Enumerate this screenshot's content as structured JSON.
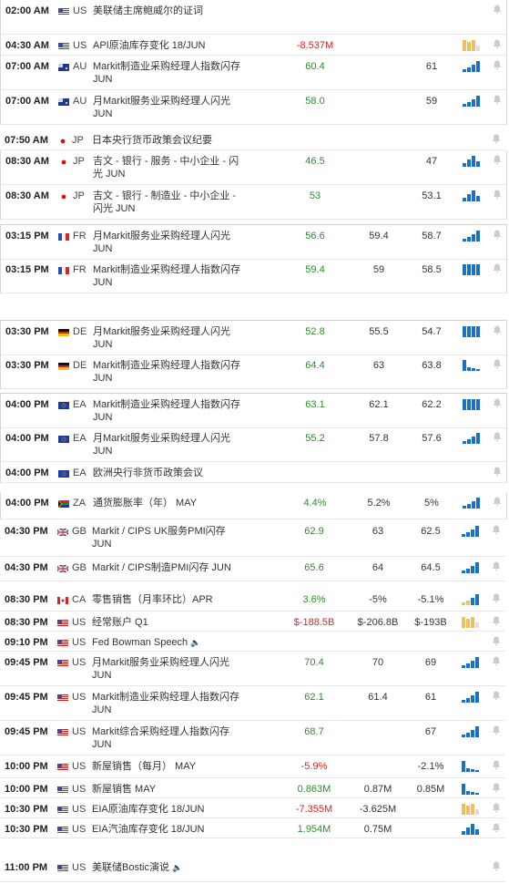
{
  "colors": {
    "positive": "#2e8b2e",
    "negative": "#dd2222",
    "bar": "#1a6fc9",
    "bar_neutral": "#f0c060",
    "bell": "#cccccc"
  },
  "rows": [
    {
      "time": "02:00 AM",
      "flag": "us-flag",
      "cc": "US",
      "event": "美联储主席鲍威尔的证词",
      "actual": "",
      "forecast": "",
      "previous": "",
      "tone": "",
      "bars": "",
      "speaker": false
    },
    {
      "time": "04:30 AM",
      "flag": "us-flag",
      "cc": "US",
      "event": "API原油库存变化 18/JUN",
      "actual": "-8.537M",
      "forecast": "",
      "previous": "",
      "tone": "neg",
      "bars": "neutral",
      "speaker": false
    },
    {
      "time": "07:00 AM",
      "flag": "au-flag",
      "cc": "AU",
      "event": "Markit制造业采购经理人指数闪存 JUN",
      "actual": "60.4",
      "forecast": "",
      "previous": "61",
      "tone": "pos",
      "bars": "up",
      "speaker": false
    },
    {
      "time": "07:00 AM",
      "flag": "au-flag",
      "cc": "AU",
      "event": "月Markit服务业采购经理人闪光 JUN",
      "actual": "58.0",
      "forecast": "",
      "previous": "59",
      "tone": "pos",
      "bars": "up",
      "speaker": false
    },
    {
      "time": "07:50 AM",
      "flag": "jp-flag",
      "cc": "JP",
      "event": "日本央行货币政策会议纪要",
      "actual": "",
      "forecast": "",
      "previous": "",
      "tone": "",
      "bars": "",
      "speaker": false
    },
    {
      "time": "08:30 AM",
      "flag": "jp-flag",
      "cc": "JP",
      "event": "吉文 - 银行 - 服务 - 中小企业 - 闪光 JUN",
      "actual": "46.5",
      "forecast": "",
      "previous": "47",
      "tone": "pos",
      "bars": "mid",
      "speaker": false
    },
    {
      "time": "08:30 AM",
      "flag": "jp-flag",
      "cc": "JP",
      "event": "吉文 - 银行 - 制造业 - 中小企业 - 闪光 JUN",
      "actual": "53",
      "forecast": "",
      "previous": "53.1",
      "tone": "pos",
      "bars": "mid",
      "speaker": false
    },
    {
      "time": "03:15 PM",
      "flag": "fr-flag",
      "cc": "FR",
      "event": "月Markit服务业采购经理人闪光 JUN",
      "actual": "56.6",
      "forecast": "59.4",
      "previous": "58.7",
      "tone": "pos",
      "bars": "up",
      "speaker": false
    },
    {
      "time": "03:15 PM",
      "flag": "fr-flag",
      "cc": "FR",
      "event": "Markit制造业采购经理人指数闪存 JUN",
      "actual": "59.4",
      "forecast": "59",
      "previous": "58.5",
      "tone": "pos",
      "bars": "full",
      "speaker": false
    },
    {
      "time": "03:30 PM",
      "flag": "de-flag",
      "cc": "DE",
      "event": "月Markit服务业采购经理人闪光 JUN",
      "actual": "52.8",
      "forecast": "55.5",
      "previous": "54.7",
      "tone": "pos",
      "bars": "full",
      "speaker": false
    },
    {
      "time": "03:30 PM",
      "flag": "de-flag",
      "cc": "DE",
      "event": "Markit制造业采购经理人指数闪存 JUN",
      "actual": "64.4",
      "forecast": "63",
      "previous": "63.8",
      "tone": "pos",
      "bars": "down",
      "speaker": false
    },
    {
      "time": "04:00 PM",
      "flag": "eu-flag",
      "cc": "EA",
      "event": "Markit制造业采购经理人指数闪存 JUN",
      "actual": "63.1",
      "forecast": "62.1",
      "previous": "62.2",
      "tone": "pos",
      "bars": "full",
      "speaker": false
    },
    {
      "time": "04:00 PM",
      "flag": "eu-flag",
      "cc": "EA",
      "event": "月Markit服务业采购经理人闪光 JUN",
      "actual": "55.2",
      "forecast": "57.8",
      "previous": "57.6",
      "tone": "pos",
      "bars": "up",
      "speaker": false
    },
    {
      "time": "04:00 PM",
      "flag": "eu-flag",
      "cc": "EA",
      "event": "欧洲央行非货币政策会议",
      "actual": "",
      "forecast": "",
      "previous": "",
      "tone": "",
      "bars": "",
      "speaker": false
    },
    {
      "time": "04:00 PM",
      "flag": "za-flag",
      "cc": "ZA",
      "event": "通货膨胀率（年） MAY",
      "actual": "4.4%",
      "forecast": "5.2%",
      "previous": "5%",
      "tone": "pos",
      "bars": "up",
      "speaker": false
    },
    {
      "time": "04:30 PM",
      "flag": "gb-flag",
      "cc": "GB",
      "event": "Markit / CIPS UK服务PMI闪存 JUN",
      "actual": "62.9",
      "forecast": "63",
      "previous": "62.5",
      "tone": "pos",
      "bars": "up",
      "speaker": false
    },
    {
      "time": "04:30 PM",
      "flag": "gb-flag",
      "cc": "GB",
      "event": "Markit / CIPS制造PMI闪存 JUN",
      "actual": "65.6",
      "forecast": "64",
      "previous": "64.5",
      "tone": "pos",
      "bars": "up",
      "speaker": false
    },
    {
      "time": "08:30 PM",
      "flag": "ca-flag",
      "cc": "CA",
      "event": "零售销售（月率环比）APR",
      "actual": "3.6%",
      "forecast": "-5%",
      "previous": "-5.1%",
      "tone": "pos",
      "bars": "neutralup",
      "speaker": false
    },
    {
      "time": "08:30 PM",
      "flag": "us-flag",
      "cc": "US",
      "event": "经常账户 Q1",
      "actual": "$-188.5B",
      "forecast": "$-206.8B",
      "previous": "$-193B",
      "tone": "neg",
      "bars": "neutral",
      "speaker": false
    },
    {
      "time": "09:10 PM",
      "flag": "us-flag",
      "cc": "US",
      "event": "Fed Bowman Speech",
      "actual": "",
      "forecast": "",
      "previous": "",
      "tone": "",
      "bars": "",
      "speaker": true
    },
    {
      "time": "09:45 PM",
      "flag": "us-flag",
      "cc": "US",
      "event": "月Markit服务业采购经理人闪光 JUN",
      "actual": "70.4",
      "forecast": "70",
      "previous": "69",
      "tone": "pos",
      "bars": "up",
      "speaker": false
    },
    {
      "time": "09:45 PM",
      "flag": "us-flag",
      "cc": "US",
      "event": "Markit制造业采购经理人指数闪存 JUN",
      "actual": "62.1",
      "forecast": "61.4",
      "previous": "61",
      "tone": "pos",
      "bars": "up",
      "speaker": false
    },
    {
      "time": "09:45 PM",
      "flag": "us-flag",
      "cc": "US",
      "event": "Markit综合采购经理人指数闪存 JUN",
      "actual": "68.7",
      "forecast": "",
      "previous": "67",
      "tone": "pos",
      "bars": "up",
      "speaker": false
    },
    {
      "time": "10:00 PM",
      "flag": "us-flag",
      "cc": "US",
      "event": "新屋销售（每月） MAY",
      "actual": "-5.9%",
      "forecast": "",
      "previous": "-2.1%",
      "tone": "neg",
      "bars": "down",
      "speaker": false
    },
    {
      "time": "10:00 PM",
      "flag": "us-flag",
      "cc": "US",
      "event": "新屋销售 MAY",
      "actual": "0.863M",
      "forecast": "0.87M",
      "previous": "0.85M",
      "tone": "pos",
      "bars": "down",
      "speaker": false
    },
    {
      "time": "10:30 PM",
      "flag": "us-flag",
      "cc": "US",
      "event": "EIA原油库存变化 18/JUN",
      "actual": "-7.355M",
      "forecast": "-3.625M",
      "previous": "",
      "tone": "neg",
      "bars": "neutral",
      "speaker": false
    },
    {
      "time": "10:30 PM",
      "flag": "us-flag",
      "cc": "US",
      "event": "EIA汽油库存变化 18/JUN",
      "actual": "1.954M",
      "forecast": "0.75M",
      "previous": "",
      "tone": "pos",
      "bars": "mid",
      "speaker": false
    },
    {
      "time": "11:00 PM",
      "flag": "us-flag",
      "cc": "US",
      "event": "美联储Bostic演说",
      "actual": "",
      "forecast": "",
      "previous": "",
      "tone": "",
      "bars": "",
      "speaker": true
    }
  ],
  "speaker_glyph": "🔈"
}
